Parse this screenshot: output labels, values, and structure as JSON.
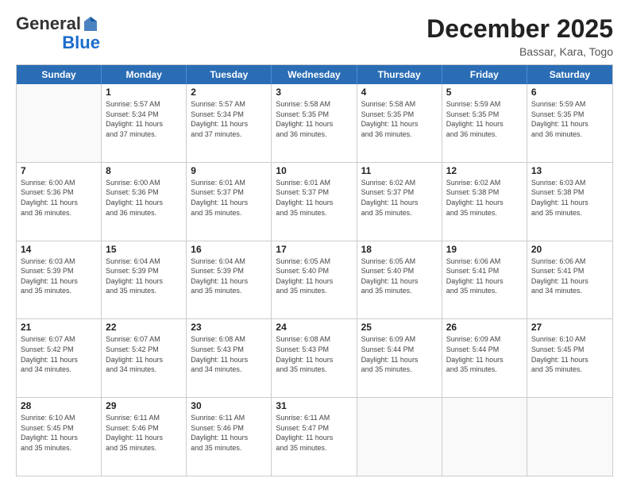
{
  "header": {
    "logo_general": "General",
    "logo_blue": "Blue",
    "cal_title": "December 2025",
    "cal_subtitle": "Bassar, Kara, Togo"
  },
  "weekdays": [
    "Sunday",
    "Monday",
    "Tuesday",
    "Wednesday",
    "Thursday",
    "Friday",
    "Saturday"
  ],
  "rows": [
    [
      {
        "date": "",
        "info": ""
      },
      {
        "date": "1",
        "info": "Sunrise: 5:57 AM\nSunset: 5:34 PM\nDaylight: 11 hours\nand 37 minutes."
      },
      {
        "date": "2",
        "info": "Sunrise: 5:57 AM\nSunset: 5:34 PM\nDaylight: 11 hours\nand 37 minutes."
      },
      {
        "date": "3",
        "info": "Sunrise: 5:58 AM\nSunset: 5:35 PM\nDaylight: 11 hours\nand 36 minutes."
      },
      {
        "date": "4",
        "info": "Sunrise: 5:58 AM\nSunset: 5:35 PM\nDaylight: 11 hours\nand 36 minutes."
      },
      {
        "date": "5",
        "info": "Sunrise: 5:59 AM\nSunset: 5:35 PM\nDaylight: 11 hours\nand 36 minutes."
      },
      {
        "date": "6",
        "info": "Sunrise: 5:59 AM\nSunset: 5:35 PM\nDaylight: 11 hours\nand 36 minutes."
      }
    ],
    [
      {
        "date": "7",
        "info": "Sunrise: 6:00 AM\nSunset: 5:36 PM\nDaylight: 11 hours\nand 36 minutes."
      },
      {
        "date": "8",
        "info": "Sunrise: 6:00 AM\nSunset: 5:36 PM\nDaylight: 11 hours\nand 36 minutes."
      },
      {
        "date": "9",
        "info": "Sunrise: 6:01 AM\nSunset: 5:37 PM\nDaylight: 11 hours\nand 35 minutes."
      },
      {
        "date": "10",
        "info": "Sunrise: 6:01 AM\nSunset: 5:37 PM\nDaylight: 11 hours\nand 35 minutes."
      },
      {
        "date": "11",
        "info": "Sunrise: 6:02 AM\nSunset: 5:37 PM\nDaylight: 11 hours\nand 35 minutes."
      },
      {
        "date": "12",
        "info": "Sunrise: 6:02 AM\nSunset: 5:38 PM\nDaylight: 11 hours\nand 35 minutes."
      },
      {
        "date": "13",
        "info": "Sunrise: 6:03 AM\nSunset: 5:38 PM\nDaylight: 11 hours\nand 35 minutes."
      }
    ],
    [
      {
        "date": "14",
        "info": "Sunrise: 6:03 AM\nSunset: 5:39 PM\nDaylight: 11 hours\nand 35 minutes."
      },
      {
        "date": "15",
        "info": "Sunrise: 6:04 AM\nSunset: 5:39 PM\nDaylight: 11 hours\nand 35 minutes."
      },
      {
        "date": "16",
        "info": "Sunrise: 6:04 AM\nSunset: 5:39 PM\nDaylight: 11 hours\nand 35 minutes."
      },
      {
        "date": "17",
        "info": "Sunrise: 6:05 AM\nSunset: 5:40 PM\nDaylight: 11 hours\nand 35 minutes."
      },
      {
        "date": "18",
        "info": "Sunrise: 6:05 AM\nSunset: 5:40 PM\nDaylight: 11 hours\nand 35 minutes."
      },
      {
        "date": "19",
        "info": "Sunrise: 6:06 AM\nSunset: 5:41 PM\nDaylight: 11 hours\nand 35 minutes."
      },
      {
        "date": "20",
        "info": "Sunrise: 6:06 AM\nSunset: 5:41 PM\nDaylight: 11 hours\nand 34 minutes."
      }
    ],
    [
      {
        "date": "21",
        "info": "Sunrise: 6:07 AM\nSunset: 5:42 PM\nDaylight: 11 hours\nand 34 minutes."
      },
      {
        "date": "22",
        "info": "Sunrise: 6:07 AM\nSunset: 5:42 PM\nDaylight: 11 hours\nand 34 minutes."
      },
      {
        "date": "23",
        "info": "Sunrise: 6:08 AM\nSunset: 5:43 PM\nDaylight: 11 hours\nand 34 minutes."
      },
      {
        "date": "24",
        "info": "Sunrise: 6:08 AM\nSunset: 5:43 PM\nDaylight: 11 hours\nand 35 minutes."
      },
      {
        "date": "25",
        "info": "Sunrise: 6:09 AM\nSunset: 5:44 PM\nDaylight: 11 hours\nand 35 minutes."
      },
      {
        "date": "26",
        "info": "Sunrise: 6:09 AM\nSunset: 5:44 PM\nDaylight: 11 hours\nand 35 minutes."
      },
      {
        "date": "27",
        "info": "Sunrise: 6:10 AM\nSunset: 5:45 PM\nDaylight: 11 hours\nand 35 minutes."
      }
    ],
    [
      {
        "date": "28",
        "info": "Sunrise: 6:10 AM\nSunset: 5:45 PM\nDaylight: 11 hours\nand 35 minutes."
      },
      {
        "date": "29",
        "info": "Sunrise: 6:11 AM\nSunset: 5:46 PM\nDaylight: 11 hours\nand 35 minutes."
      },
      {
        "date": "30",
        "info": "Sunrise: 6:11 AM\nSunset: 5:46 PM\nDaylight: 11 hours\nand 35 minutes."
      },
      {
        "date": "31",
        "info": "Sunrise: 6:11 AM\nSunset: 5:47 PM\nDaylight: 11 hours\nand 35 minutes."
      },
      {
        "date": "",
        "info": ""
      },
      {
        "date": "",
        "info": ""
      },
      {
        "date": "",
        "info": ""
      }
    ]
  ]
}
